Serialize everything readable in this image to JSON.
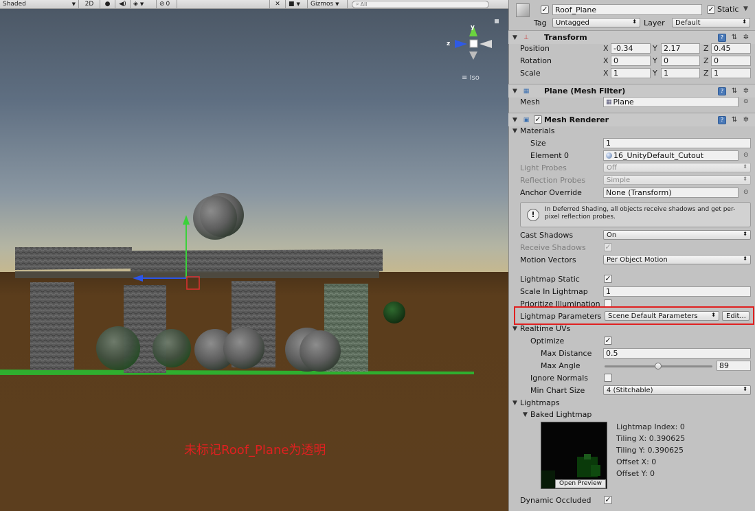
{
  "scene": {
    "toolbar": {
      "draw_mode": "Shaded",
      "mode_2d": "2D",
      "light_icon": "lightbulb-icon",
      "audio_icon": "speaker-icon",
      "effects_icon": "layers-icon",
      "hidden_count": "0",
      "tools_icon": "crossed-tools-icon",
      "camera_icon": "camera-icon",
      "gizmos_label": "Gizmos",
      "search_placeholder": "All"
    },
    "gizmo": {
      "y_label": "y",
      "z_label": "z",
      "projection_label": "≡ Iso"
    },
    "caption": "未标记Roof_Plane为透明"
  },
  "inspector": {
    "object": {
      "name": "Roof_Plane",
      "active": true,
      "static_label": "Static",
      "static_checked": true,
      "tag_label": "Tag",
      "tag_value": "Untagged",
      "layer_label": "Layer",
      "layer_value": "Default"
    },
    "transform": {
      "title": "Transform",
      "position_label": "Position",
      "rotation_label": "Rotation",
      "scale_label": "Scale",
      "position": {
        "x": "-0.34",
        "y": "2.17",
        "z": "0.45"
      },
      "rotation": {
        "x": "0",
        "y": "0",
        "z": "0"
      },
      "scale": {
        "x": "1",
        "y": "1",
        "z": "1"
      },
      "axis_x": "X",
      "axis_y": "Y",
      "axis_z": "Z"
    },
    "mesh_filter": {
      "title": "Plane (Mesh Filter)",
      "mesh_label": "Mesh",
      "mesh_value": "Plane"
    },
    "mesh_renderer": {
      "title": "Mesh Renderer",
      "enabled": true,
      "materials_label": "Materials",
      "size_label": "Size",
      "size_value": "1",
      "element0_label": "Element 0",
      "element0_value": "16_UnityDefault_Cutout",
      "light_probes_label": "Light Probes",
      "light_probes_value": "Off",
      "reflection_probes_label": "Reflection Probes",
      "reflection_probes_value": "Simple",
      "anchor_override_label": "Anchor Override",
      "anchor_override_value": "None (Transform)",
      "deferred_info": "In Deferred Shading, all objects receive shadows and get per-pixel reflection probes.",
      "cast_shadows_label": "Cast Shadows",
      "cast_shadows_value": "On",
      "receive_shadows_label": "Receive Shadows",
      "receive_shadows_checked": true,
      "motion_vectors_label": "Motion Vectors",
      "motion_vectors_value": "Per Object Motion",
      "lightmap_static_label": "Lightmap Static",
      "lightmap_static_checked": true,
      "scale_in_lightmap_label": "Scale In Lightmap",
      "scale_in_lightmap_value": "1",
      "prioritize_illumination_label": "Prioritize Illumination",
      "prioritize_illumination_checked": false,
      "lightmap_parameters_label": "Lightmap Parameters",
      "lightmap_parameters_value": "Scene Default Parameters",
      "edit_button": "Edit...",
      "realtime_uvs_label": "Realtime UVs",
      "optimize_label": "Optimize",
      "optimize_checked": true,
      "max_distance_label": "Max Distance",
      "max_distance_value": "0.5",
      "max_angle_label": "Max Angle",
      "max_angle_value": "89",
      "max_angle_fraction": 0.494,
      "ignore_normals_label": "Ignore Normals",
      "ignore_normals_checked": false,
      "min_chart_size_label": "Min Chart Size",
      "min_chart_size_value": "4 (Stitchable)",
      "lightmaps_label": "Lightmaps",
      "baked_lightmap_label": "Baked Lightmap",
      "lightmap_index": "Lightmap Index: 0",
      "tiling_x": "Tiling X: 0.390625",
      "tiling_y": "Tiling Y: 0.390625",
      "offset_x": "Offset X: 0",
      "offset_y": "Offset Y: 0",
      "open_preview": "Open Preview",
      "dynamic_occluded_label": "Dynamic Occluded",
      "dynamic_occluded_checked": true
    }
  },
  "colors": {
    "highlight": "#e02020",
    "caption": "#e02020"
  }
}
